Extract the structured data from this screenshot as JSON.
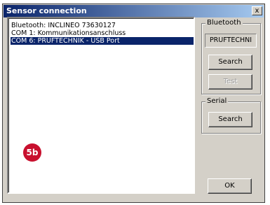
{
  "window": {
    "title": "Sensor connection",
    "close_label": "x"
  },
  "devices": [
    {
      "label": "Bluetooth: INCLINEO 73630127",
      "selected": false
    },
    {
      "label": "COM  1: Kommunikationsanschluss",
      "selected": false
    },
    {
      "label": "COM  6: PRUFTECHNIK - USB Port",
      "selected": true
    }
  ],
  "marker": "5b",
  "bluetooth": {
    "group_label": "Bluetooth",
    "device_name": "PRUFTECHNI",
    "search_label": "Search",
    "test_label": "Test"
  },
  "serial": {
    "group_label": "Serial",
    "search_label": "Search"
  },
  "ok_label": "OK"
}
